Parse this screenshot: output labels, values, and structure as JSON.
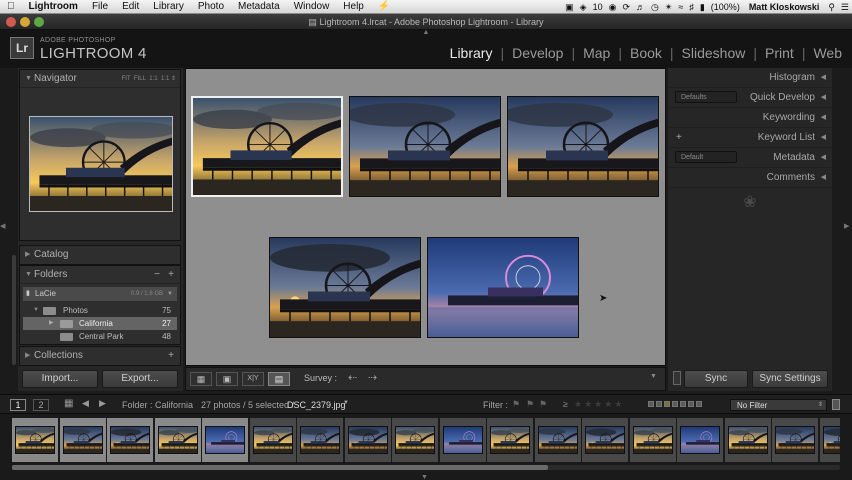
{
  "menubar": {
    "apple_icon": "apple-icon",
    "app": "Lightroom",
    "items": [
      "File",
      "Edit",
      "Library",
      "Photo",
      "Metadata",
      "Window",
      "Help"
    ],
    "status": {
      "battery": "(100%)",
      "badge": "10",
      "user": "Matt Kloskowski"
    }
  },
  "window": {
    "title": "Lightroom 4.lrcat - Adobe Photoshop Lightroom - Library"
  },
  "identity": {
    "logo": "Lr",
    "line1": "ADOBE PHOTOSHOP",
    "line2": "LIGHTROOM 4"
  },
  "modules": [
    "Library",
    "Develop",
    "Map",
    "Book",
    "Slideshow",
    "Print",
    "Web"
  ],
  "active_module": "Library",
  "left_panel": {
    "navigator": {
      "title": "Navigator",
      "options": [
        "FIT",
        "FILL",
        "1:1",
        "1:1"
      ]
    },
    "catalog": {
      "title": "Catalog"
    },
    "folders": {
      "title": "Folders",
      "volume": {
        "name": "LaCie",
        "space": "0.9 / 1.8 GB"
      },
      "tree": [
        {
          "name": "Photos",
          "count": "75"
        },
        {
          "name": "California",
          "count": "27"
        },
        {
          "name": "Central Park",
          "count": "48"
        }
      ]
    },
    "collections": {
      "title": "Collections"
    },
    "import_label": "Import...",
    "export_label": "Export..."
  },
  "right_panel": {
    "sections": [
      {
        "title": "Histogram",
        "preset": ""
      },
      {
        "title": "Quick Develop",
        "preset": "Defaults"
      },
      {
        "title": "Keywording",
        "preset": ""
      },
      {
        "title": "Keyword List",
        "preset": ""
      },
      {
        "title": "Metadata",
        "preset": "Default"
      },
      {
        "title": "Comments",
        "preset": ""
      }
    ],
    "sync_label": "Sync",
    "sync_settings_label": "Sync Settings"
  },
  "toolbar": {
    "survey_label": "Survey :"
  },
  "filmstrip_bar": {
    "pages": [
      "1",
      "2"
    ],
    "folder": "Folder : California",
    "status": "27 photos / 5 selected /",
    "filename": "DSC_2379.jpg",
    "filter_label": "Filter :",
    "filter_value": "No Filter"
  },
  "survey_photo_count": 5,
  "selected_survey_index": 0,
  "filmstrip_count": 18,
  "selected_filmstrip": [
    0,
    1,
    2,
    3,
    4
  ],
  "icons": [
    "apple-icon",
    "spotlight-icon",
    "wifi-icon",
    "bluetooth-icon",
    "grid-view-icon",
    "loupe-view-icon",
    "compare-view-icon",
    "survey-view-icon",
    "previous-arrow-icon",
    "next-arrow-icon",
    "swap-icon",
    "unlock-icon",
    "add-icon",
    "minus-icon",
    "flag-icon",
    "star-icon",
    "color-label-icon",
    "mouse-cursor-icon",
    "scroll-arrow-icon"
  ]
}
